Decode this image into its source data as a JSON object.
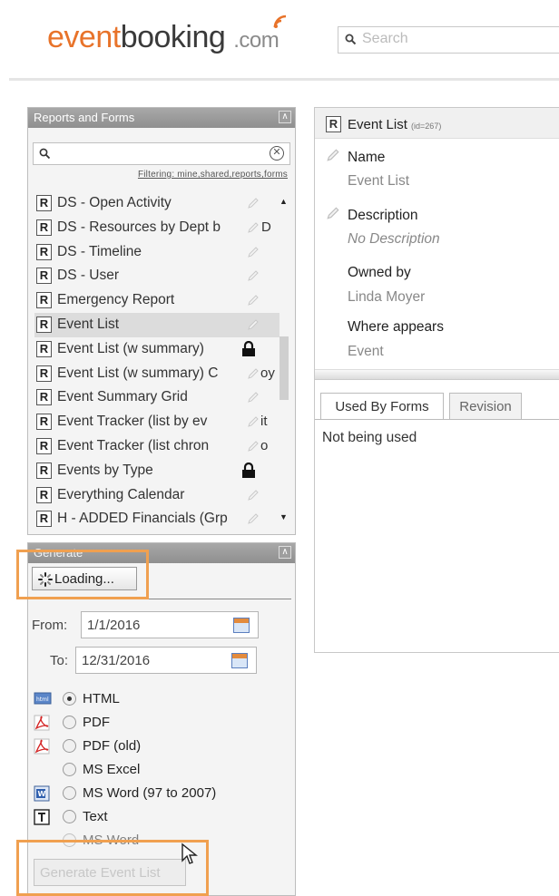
{
  "header": {
    "logo_part1": "event",
    "logo_part2": "booking",
    "logo_part3": ".com",
    "search_placeholder": "Search",
    "brand_color": "#e8732a"
  },
  "reports_panel": {
    "title": "Reports and Forms",
    "filter_text": "Filtering: mine,shared,reports,forms",
    "items": [
      {
        "badge": "R",
        "name": "DS - Open Activity",
        "tail": "",
        "icon": "pencil-icon"
      },
      {
        "badge": "R",
        "name": "DS - Resources by Dept b",
        "tail": "D",
        "icon": "pencil-icon"
      },
      {
        "badge": "R",
        "name": "DS - Timeline",
        "tail": "",
        "icon": "pencil-icon"
      },
      {
        "badge": "R",
        "name": "DS - User",
        "tail": "",
        "icon": "pencil-icon"
      },
      {
        "badge": "R",
        "name": "Emergency Report",
        "tail": "",
        "icon": "pencil-icon"
      },
      {
        "badge": "R",
        "name": "Event List",
        "tail": "",
        "icon": "pencil-icon",
        "selected": true
      },
      {
        "badge": "R",
        "name": "Event List (w summary)",
        "tail": "",
        "icon": "lock-icon"
      },
      {
        "badge": "R",
        "name": "Event List (w summary) C",
        "tail": "oy",
        "icon": "pencil-icon"
      },
      {
        "badge": "R",
        "name": "Event Summary Grid",
        "tail": "",
        "icon": "pencil-icon"
      },
      {
        "badge": "R",
        "name": "Event Tracker (list by ev",
        "tail": "it",
        "icon": "pencil-icon"
      },
      {
        "badge": "R",
        "name": "Event Tracker (list chron",
        "tail": "o",
        "icon": "pencil-icon"
      },
      {
        "badge": "R",
        "name": "Events by Type",
        "tail": "",
        "icon": "lock-icon"
      },
      {
        "badge": "R",
        "name": "Everything Calendar",
        "tail": "",
        "icon": "pencil-icon"
      },
      {
        "badge": "R",
        "name": "H - ADDED Financials (Grp",
        "tail": "",
        "icon": "pencil-icon"
      }
    ]
  },
  "generate_panel": {
    "title": "Generate",
    "loading_label": "Loading...",
    "from_label": "From:",
    "from_value": "1/1/2016",
    "to_label": "To:",
    "to_value": "12/31/2016",
    "formats": [
      {
        "label": "HTML",
        "icon": "html-icon",
        "selected": true
      },
      {
        "label": "PDF",
        "icon": "pdf-icon",
        "selected": false
      },
      {
        "label": "PDF (old)",
        "icon": "pdf-icon",
        "selected": false
      },
      {
        "label": "MS Excel",
        "icon": "",
        "selected": false
      },
      {
        "label": "MS Word (97 to 2007)",
        "icon": "word-icon",
        "selected": false
      },
      {
        "label": "Text",
        "icon": "text-icon",
        "selected": false
      },
      {
        "label": "MS Word",
        "icon": "",
        "selected": false
      }
    ],
    "generate_button": "Generate Event List",
    "highlight_color": "#f0a050"
  },
  "detail_panel": {
    "badge": "R",
    "title": "Event List",
    "id_text": "(id=267)",
    "name_label": "Name",
    "name_value": "Event List",
    "description_label": "Description",
    "description_value": "No Description",
    "owned_by_label": "Owned by",
    "owned_by_value": "Linda Moyer",
    "where_label": "Where appears",
    "where_value": "Event",
    "tabs": [
      "Used By Forms",
      "Revision"
    ],
    "active_tab": "Used By Forms",
    "empty_text": "Not being used"
  }
}
